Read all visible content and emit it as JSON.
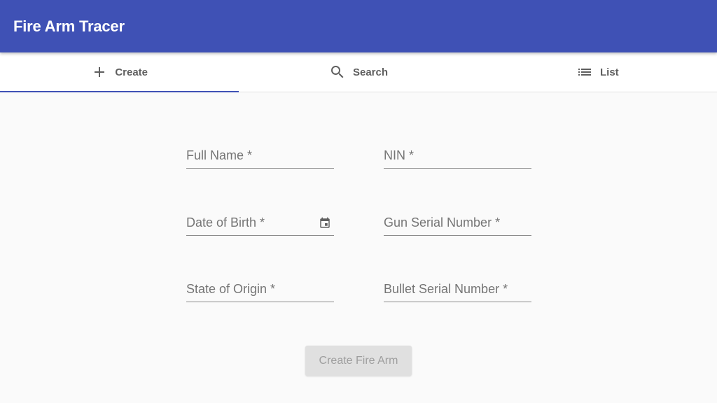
{
  "app": {
    "title": "Fire Arm Tracer",
    "accent_color": "#3f51b5"
  },
  "tabs": [
    {
      "label": "Create",
      "icon": "plus-icon",
      "active": true
    },
    {
      "label": "Search",
      "icon": "search-icon",
      "active": false
    },
    {
      "label": "List",
      "icon": "list-icon",
      "active": false
    }
  ],
  "form": {
    "full_name": {
      "placeholder": "Full Name *",
      "value": ""
    },
    "nin": {
      "placeholder": "NIN *",
      "value": ""
    },
    "date_of_birth": {
      "placeholder": "Date of Birth *",
      "value": "",
      "icon": "calendar-icon"
    },
    "gun_serial": {
      "placeholder": "Gun Serial Number *",
      "value": ""
    },
    "state_of_origin": {
      "placeholder": "State of Origin *",
      "value": ""
    },
    "bullet_serial": {
      "placeholder": "Bullet Serial Number *",
      "value": ""
    },
    "submit_label": "Create Fire Arm",
    "submit_disabled": true
  }
}
